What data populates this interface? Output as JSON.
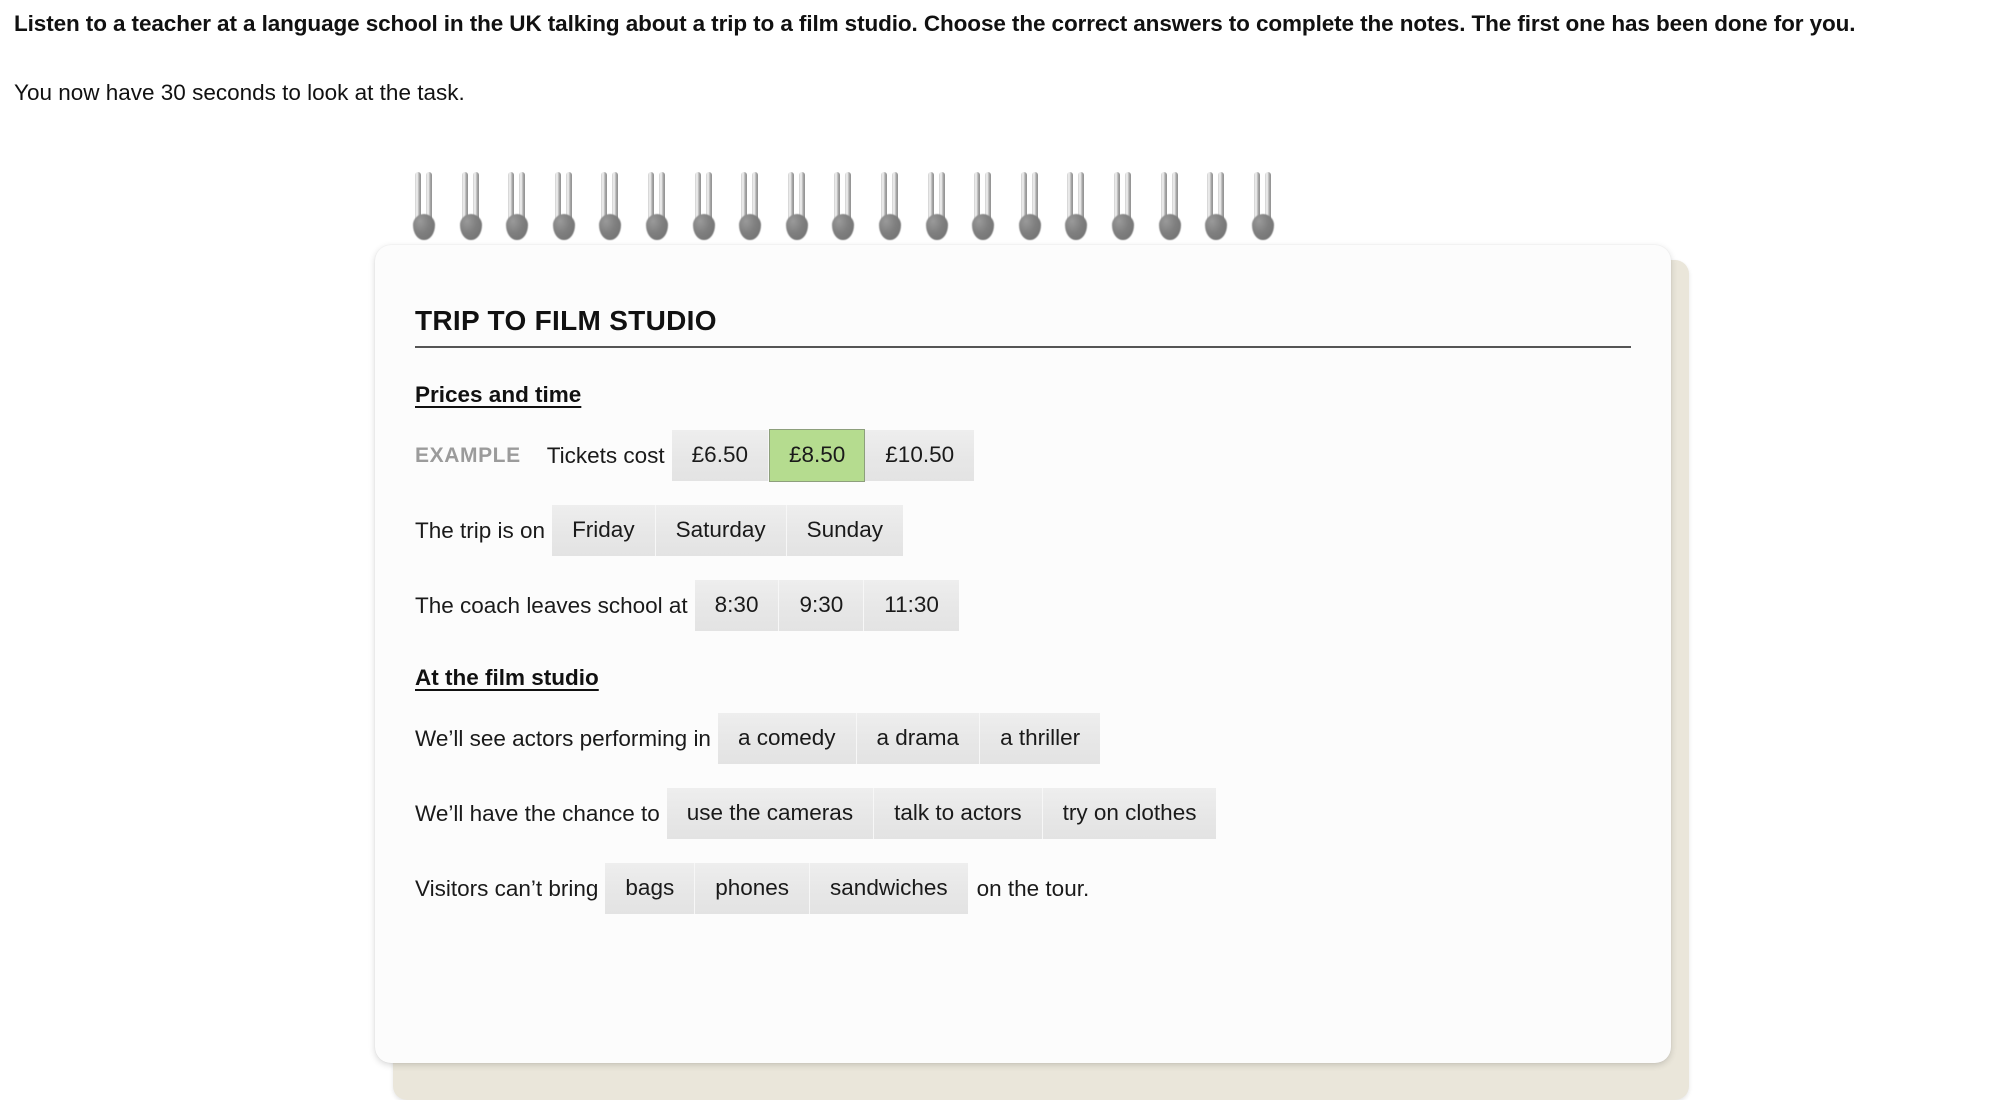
{
  "instructions": {
    "bold": "Listen to a teacher at a language school in the UK talking about a trip to a film studio. Choose the correct answers to complete the notes. The first one has been done for you.",
    "normal": "You now have 30 seconds to look at the task."
  },
  "notepad": {
    "title": "TRIP TO FILM STUDIO",
    "spiral_ring_count": 19,
    "sections": [
      {
        "heading": "Prices and time",
        "rows": [
          {
            "example_label": "EXAMPLE",
            "lead_text": "Tickets cost",
            "options": [
              "£6.50",
              "£8.50",
              "£10.50"
            ],
            "selected_index": 1,
            "trail_text": ""
          },
          {
            "example_label": "",
            "lead_text": "The trip is on",
            "options": [
              "Friday",
              "Saturday",
              "Sunday"
            ],
            "selected_index": -1,
            "trail_text": ""
          },
          {
            "example_label": "",
            "lead_text": "The coach leaves school at",
            "options": [
              "8:30",
              "9:30",
              "11:30"
            ],
            "selected_index": -1,
            "trail_text": ""
          }
        ]
      },
      {
        "heading": "At the film studio",
        "rows": [
          {
            "example_label": "",
            "lead_text": "We’ll see actors performing in",
            "options": [
              "a comedy",
              "a drama",
              "a thriller"
            ],
            "selected_index": -1,
            "trail_text": ""
          },
          {
            "example_label": "",
            "lead_text": "We’ll have the chance to",
            "options": [
              "use the cameras",
              "talk to actors",
              "try on clothes"
            ],
            "selected_index": -1,
            "trail_text": ""
          },
          {
            "example_label": "",
            "lead_text": "Visitors can’t bring",
            "options": [
              "bags",
              "phones",
              "sandwiches"
            ],
            "selected_index": -1,
            "trail_text": "on the tour."
          }
        ]
      }
    ]
  },
  "colors": {
    "selected_option_bg": "#b5dc8f",
    "selected_option_border": "#8d9f7c",
    "option_bg": "#e8e8e8",
    "example_label": "#9b9b9b",
    "paper_front": "#fcfcfc",
    "paper_back": "#eae6da",
    "title_rule": "#555555",
    "text": "#1a1a1a"
  }
}
